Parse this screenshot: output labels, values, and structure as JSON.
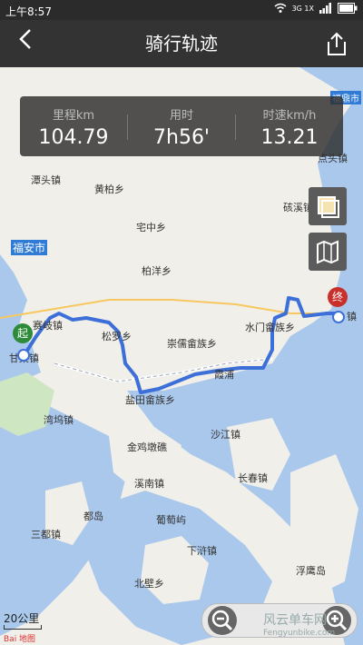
{
  "status_bar": {
    "time": "上午8:57",
    "network": "3G 1X"
  },
  "app_bar": {
    "title": "骑行轨迹"
  },
  "stats": [
    {
      "label": "里程km",
      "value": "104.79"
    },
    {
      "label": "用时",
      "value": "7h56'"
    },
    {
      "label": "时速km/h",
      "value": "13.21"
    }
  ],
  "map": {
    "labels": {
      "tanTou": "潭头镇",
      "huangBai": "黄柏乡",
      "zhaiZhong": "宅中乡",
      "fuAn": "福安市",
      "baiYang": "柏洋乡",
      "saiQi": "赛岐镇",
      "ganTang": "甘棠镇",
      "songLuo": "松罗乡",
      "chongRu": "崇儒畲族乡",
      "shuiMen": "水门畲族乡",
      "xiaPu": "霞浦",
      "yanTian": "盐田畲族乡",
      "wanWu": "湾坞镇",
      "shaJiang": "沙江镇",
      "jinJiTun": "金鸡墩礁",
      "xiNan": "溪南镇",
      "changChun": "长春镇",
      "duDao": "都岛",
      "puTao": "葡萄屿",
      "sanDu": "三都镇",
      "xiaHu": "下浒镇",
      "fuYing": "浮鹰岛",
      "beiBi": "北壁乡",
      "dianXi": "硋溪镇",
      "dianXia": "点头镇",
      "fuDingShi": "福鼎市",
      "zhenNan": "镇",
      "pingYang": "柏洋"
    },
    "start_marker": "起",
    "end_marker": "终",
    "scale": "20公里",
    "baidu": "Bai 地图"
  },
  "watermark": {
    "line1": "风云单车网",
    "line2": "Fengyunbike.com"
  },
  "colors": {
    "route": "#3d6fd8",
    "start": "#2e8b3a",
    "end": "#c9302c"
  }
}
